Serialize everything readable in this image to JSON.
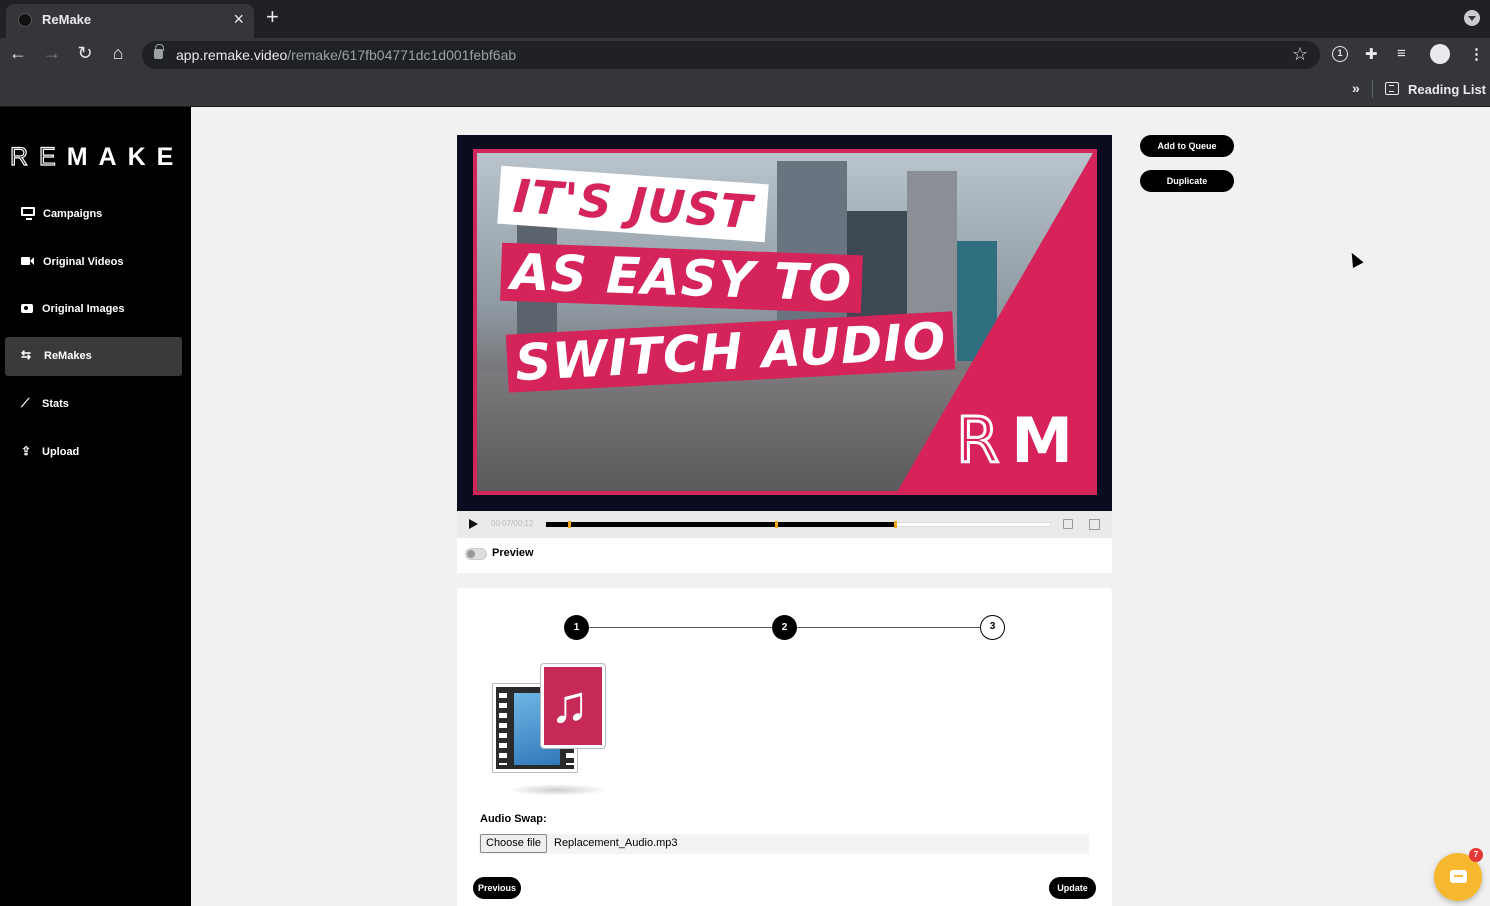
{
  "browser": {
    "tab_title": "ReMake",
    "url_host": "app.remake.video",
    "url_path": "/remake/617fb04771dc1d001febf6ab",
    "reading_list": "Reading List",
    "extension_badge": "1"
  },
  "sidebar": {
    "logo_outline": "RE",
    "logo_solid": "MAKE",
    "items": [
      {
        "label": "Campaigns",
        "icon": "monitor-icon"
      },
      {
        "label": "Original Videos",
        "icon": "video-camera-icon"
      },
      {
        "label": "Original Images",
        "icon": "camera-icon"
      },
      {
        "label": "ReMakes",
        "icon": "repeat-icon",
        "active": true
      },
      {
        "label": "Stats",
        "icon": "line-chart-icon"
      },
      {
        "label": "Upload",
        "icon": "upload-icon"
      }
    ]
  },
  "video": {
    "line1": "IT'S JUST",
    "line2": "AS EASY TO",
    "line3": "SWITCH AUDIO",
    "logo_r": "R",
    "logo_m": "M",
    "time": "00:07/00:12",
    "progress": 0.69,
    "markers": [
      0.045,
      0.455,
      0.69
    ],
    "preview_label": "Preview"
  },
  "actions": {
    "add_to_queue": "Add to Queue",
    "duplicate": "Duplicate"
  },
  "steps": {
    "items": [
      "1",
      "2",
      "3"
    ],
    "current": 2
  },
  "audio": {
    "label": "Audio Swap:",
    "choose_file": "Choose file",
    "file_name": "Replacement_Audio.mp3"
  },
  "nav_buttons": {
    "previous": "Previous",
    "update": "Update"
  },
  "chat": {
    "badge": "7"
  }
}
